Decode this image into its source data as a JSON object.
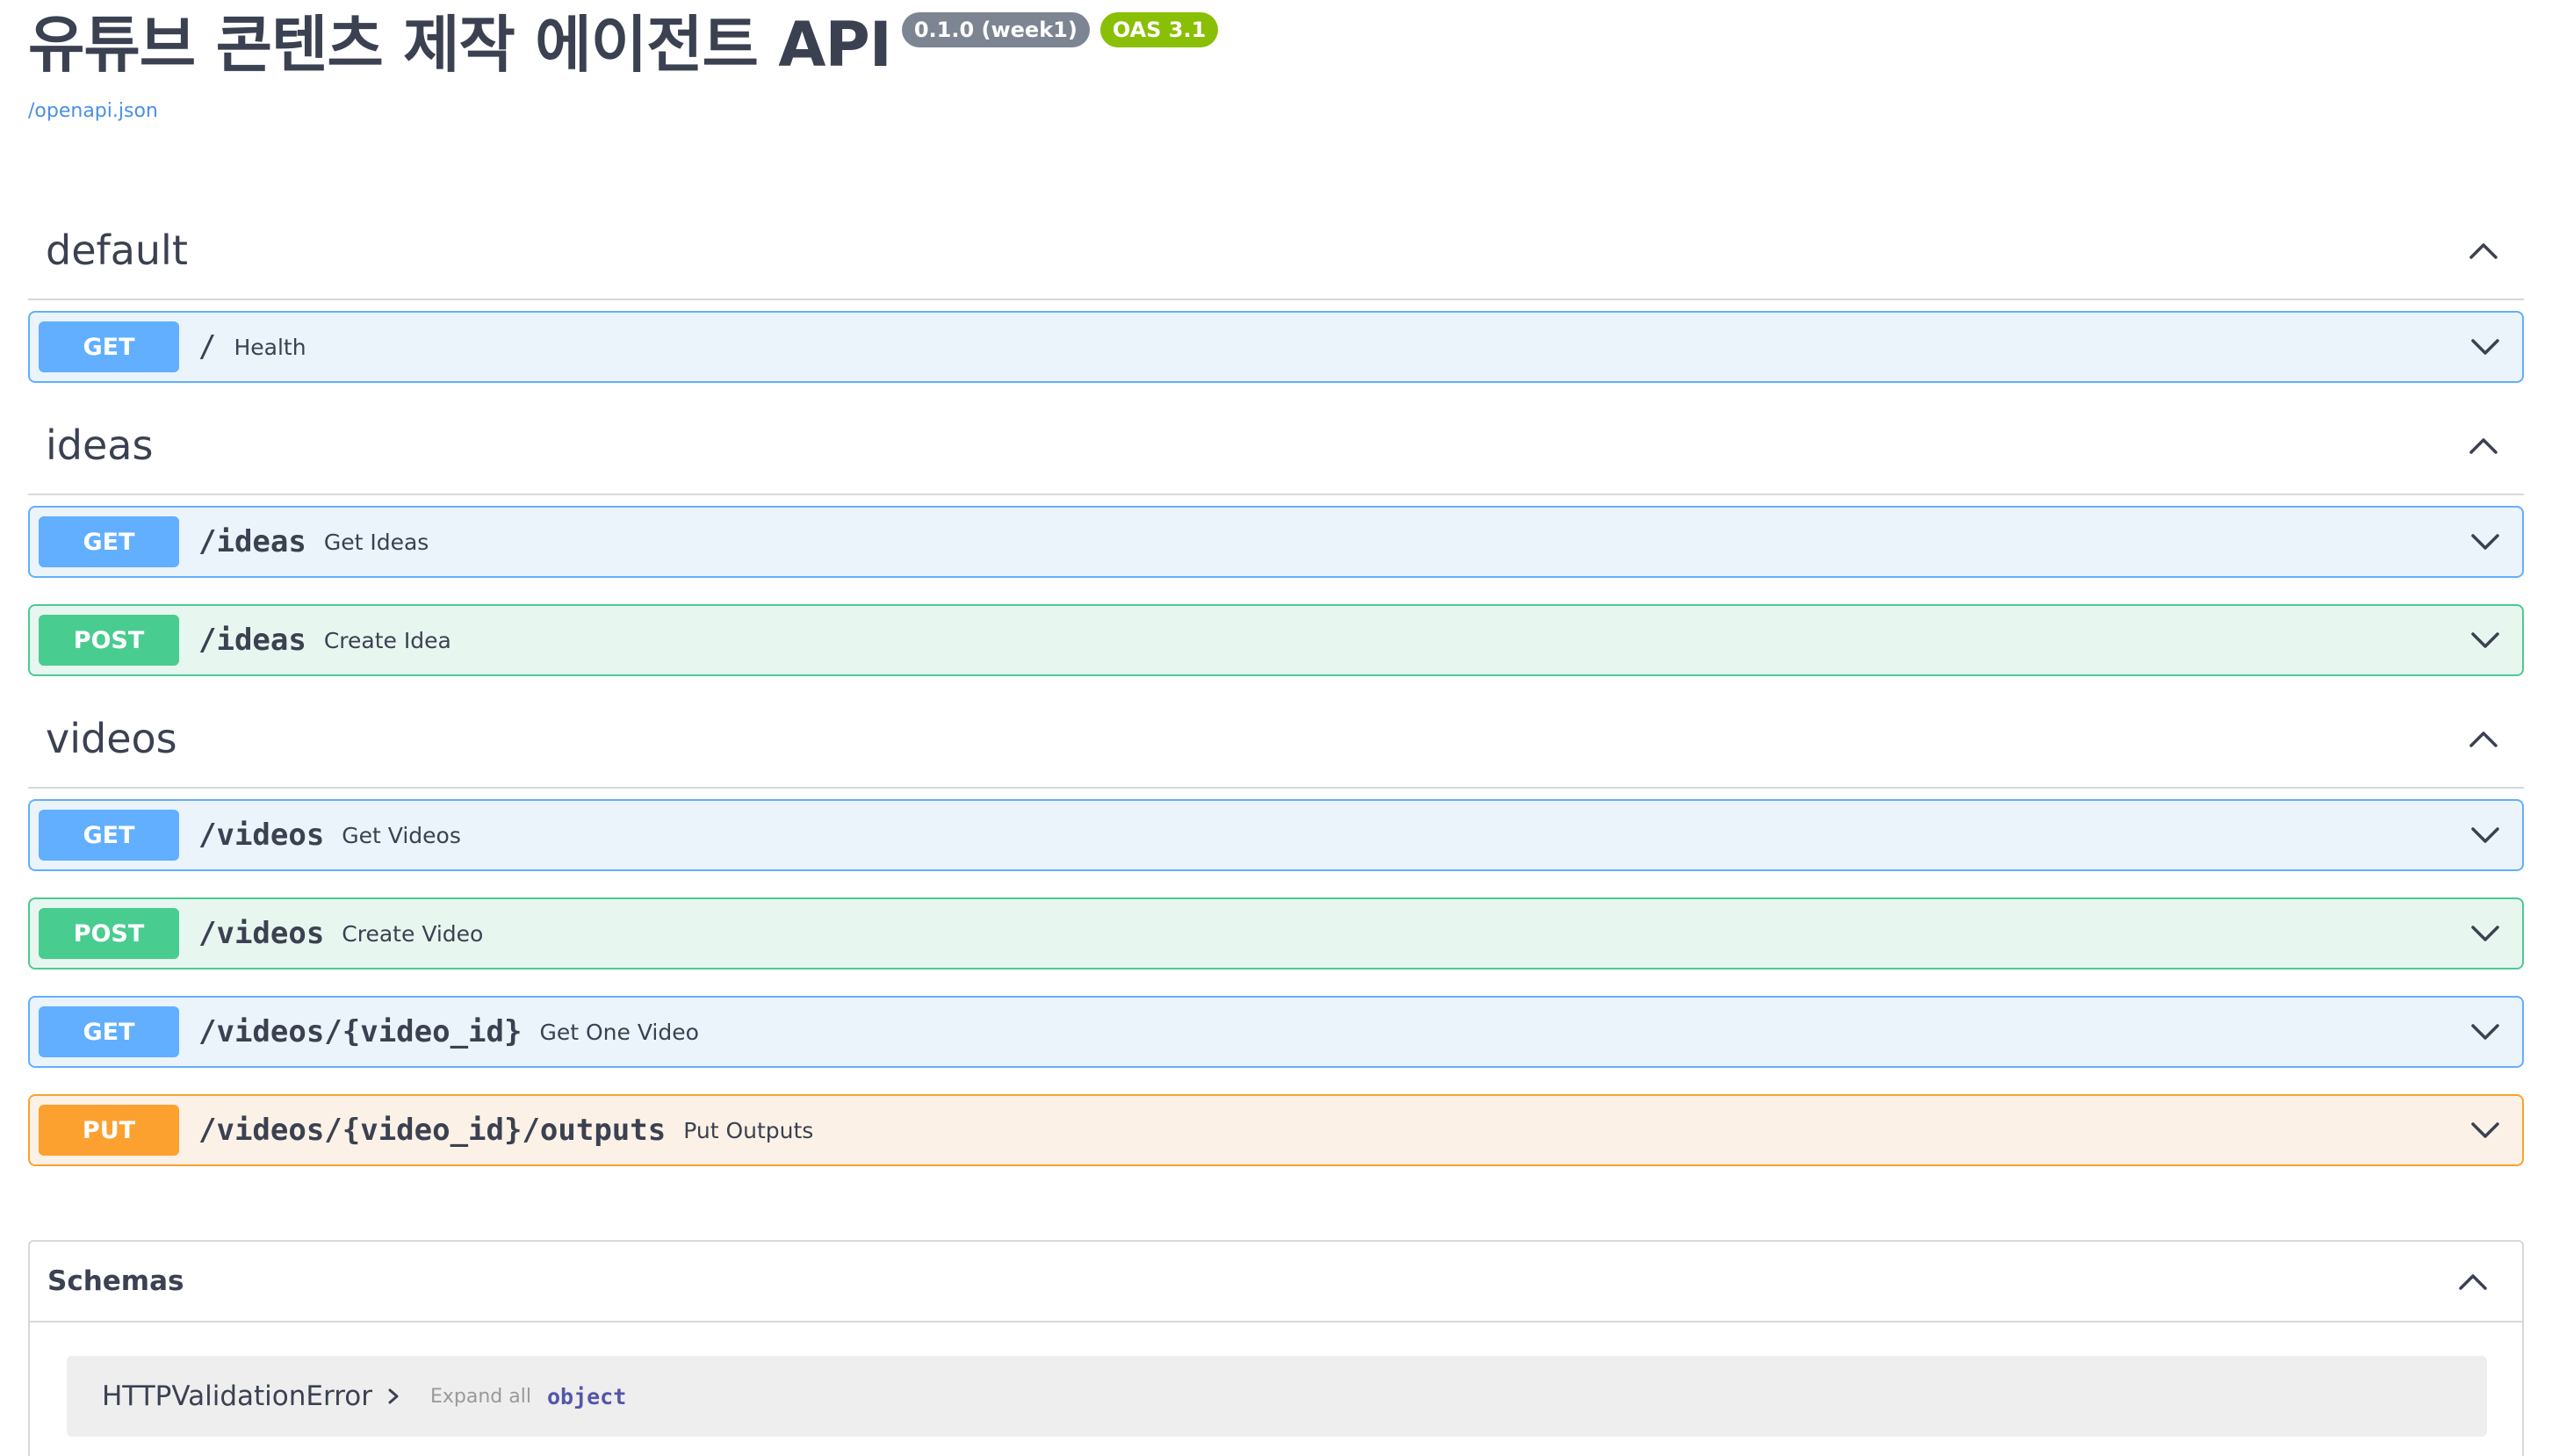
{
  "info": {
    "title": "유튜브 콘텐츠 제작 에이전트 API",
    "version_badge": "0.1.0 (week1)",
    "oas_badge": "OAS 3.1",
    "spec_link": "/openapi.json"
  },
  "colors": {
    "get": "#61affe",
    "post": "#49cc90",
    "put": "#fca130",
    "oas_badge": "#89bf04",
    "version_badge": "#7d8492"
  },
  "tags": [
    {
      "name": "default",
      "operations": [
        {
          "method": "GET",
          "path": "/",
          "summary": "Health"
        }
      ]
    },
    {
      "name": "ideas",
      "operations": [
        {
          "method": "GET",
          "path": "/ideas",
          "summary": "Get Ideas"
        },
        {
          "method": "POST",
          "path": "/ideas",
          "summary": "Create Idea"
        }
      ]
    },
    {
      "name": "videos",
      "operations": [
        {
          "method": "GET",
          "path": "/videos",
          "summary": "Get Videos"
        },
        {
          "method": "POST",
          "path": "/videos",
          "summary": "Create Video"
        },
        {
          "method": "GET",
          "path": "/videos/{video_id}",
          "summary": "Get One Video"
        },
        {
          "method": "PUT",
          "path": "/videos/{video_id}/outputs",
          "summary": "Put Outputs"
        }
      ]
    }
  ],
  "schemas": {
    "title": "Schemas",
    "items": [
      {
        "name": "HTTPValidationError",
        "expand_label": "Expand all",
        "type": "object"
      }
    ]
  }
}
